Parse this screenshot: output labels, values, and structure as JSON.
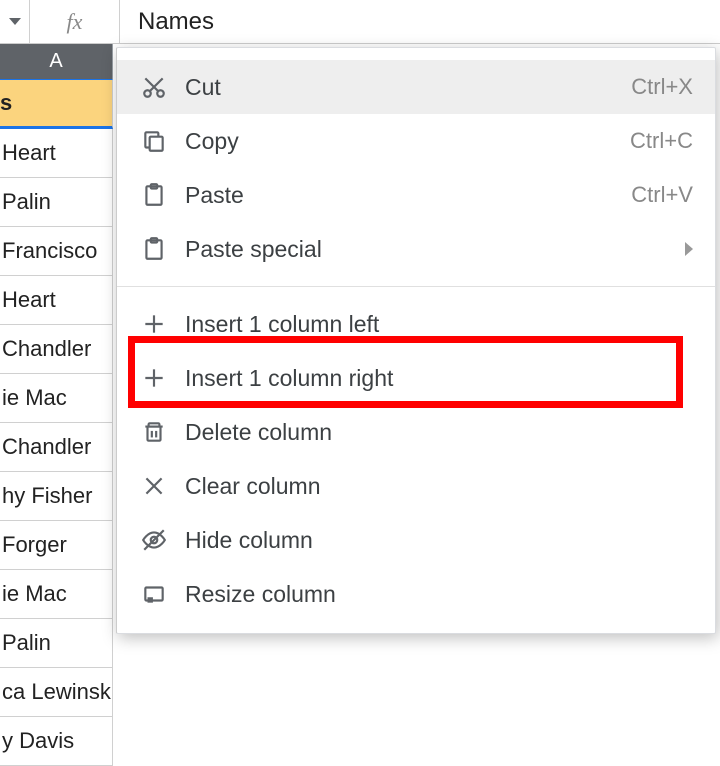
{
  "formula_bar": {
    "fx_label": "fx",
    "value": "Names"
  },
  "column_header": "A",
  "cells": [
    "s",
    " Heart",
    " Palin",
    "Francisco",
    " Heart",
    " Chandler",
    "ie Mac",
    " Chandler",
    "hy Fisher",
    "Forger",
    "ie Mac",
    " Palin",
    "ca Lewinsk",
    "y Davis"
  ],
  "menu": {
    "cut": {
      "label": "Cut",
      "shortcut": "Ctrl+X"
    },
    "copy": {
      "label": "Copy",
      "shortcut": "Ctrl+C"
    },
    "paste": {
      "label": "Paste",
      "shortcut": "Ctrl+V"
    },
    "paste_special": {
      "label": "Paste special"
    },
    "insert_left": {
      "label": "Insert 1 column left"
    },
    "insert_right": {
      "label": "Insert 1 column right"
    },
    "delete": {
      "label": "Delete column"
    },
    "clear": {
      "label": "Clear column"
    },
    "hide": {
      "label": "Hide column"
    },
    "resize": {
      "label": "Resize column"
    }
  }
}
